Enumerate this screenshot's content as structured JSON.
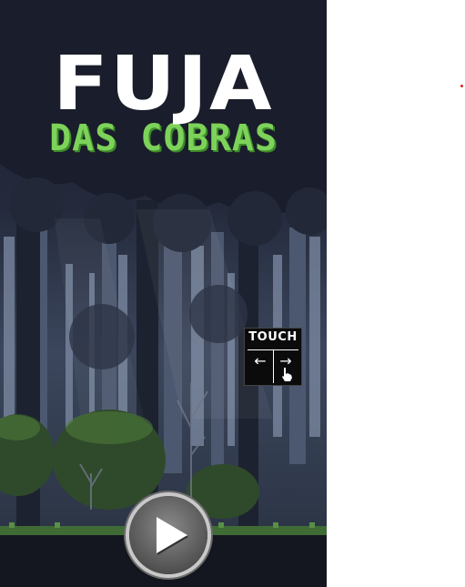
{
  "game": {
    "title_main": "FUJA",
    "title_sub": "DAS COBRAS",
    "title_color": "#ffffff",
    "subtitle_color": "#7dd35a"
  },
  "controls": {
    "touch_label": "TOUCH",
    "left_arrow": "←",
    "right_arrow": "→",
    "hand_icon": "pointer-hand-icon",
    "play_icon": "play-icon"
  }
}
